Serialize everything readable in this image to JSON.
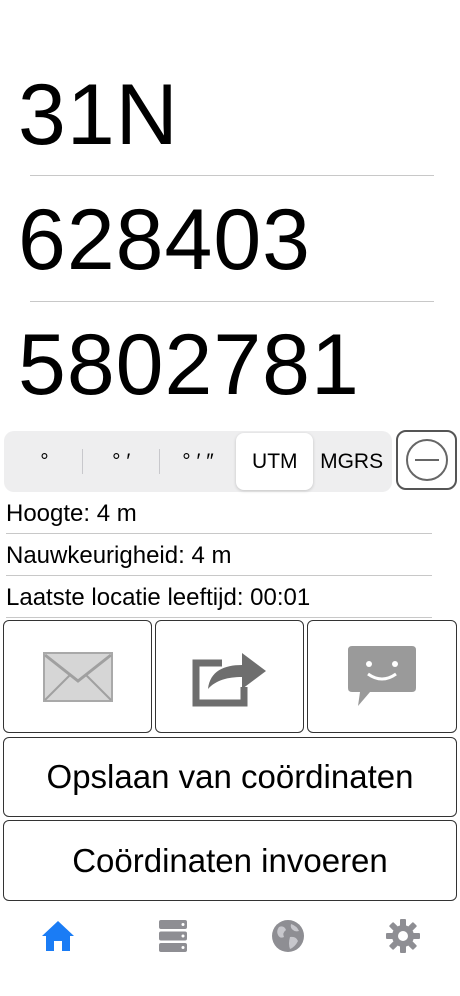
{
  "coordinates": {
    "zone": "31N",
    "easting": "628403",
    "northing": "5802781"
  },
  "format_selector": {
    "options": [
      "°",
      "° ′",
      "° ′ ″",
      "UTM",
      "MGRS"
    ],
    "selected": "UTM"
  },
  "info": {
    "altitude": "Hoogte: 4 m",
    "accuracy": "Nauwkeurigheid: 4 m",
    "location_age": "Laatste locatie leeftijd: 00:01"
  },
  "actions": {
    "save_label": "Opslaan van coördinaten",
    "enter_label": "Coördinaten invoeren"
  },
  "icons": {
    "mail": "mail-icon",
    "share": "share-icon",
    "message": "message-icon",
    "remove": "minus-circle-icon"
  },
  "tabbar": {
    "items": [
      "home-icon",
      "list-icon",
      "globe-icon",
      "gear-icon"
    ],
    "active": "home-icon",
    "active_color": "#1a7cf5",
    "inactive_color": "#8e8e93"
  }
}
